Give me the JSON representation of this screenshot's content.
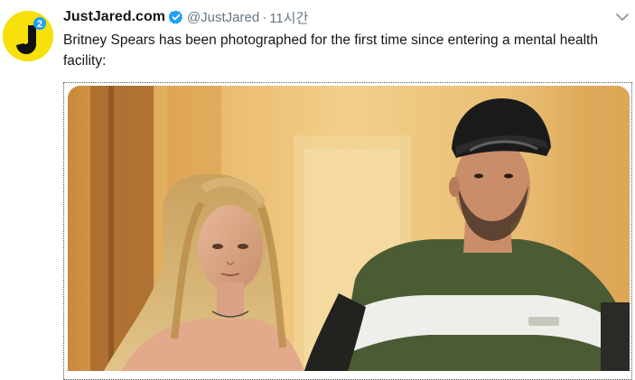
{
  "tweet": {
    "display_name": "JustJared.com",
    "handle": "@JustJared",
    "separator": "·",
    "time": "11시간",
    "text": "Britney Spears has been photographed for the first time since entering a mental health facility:",
    "verified_icon": "verified-badge-icon",
    "more_icon": "chevron-down-icon"
  },
  "avatar": {
    "logo_icon": "justjared-logo",
    "brand_color": "#f6e10a",
    "badge_color": "#1da1f2"
  },
  "media": {
    "kind": "photo",
    "subject": "photo-of-two-people-in-hallway"
  }
}
